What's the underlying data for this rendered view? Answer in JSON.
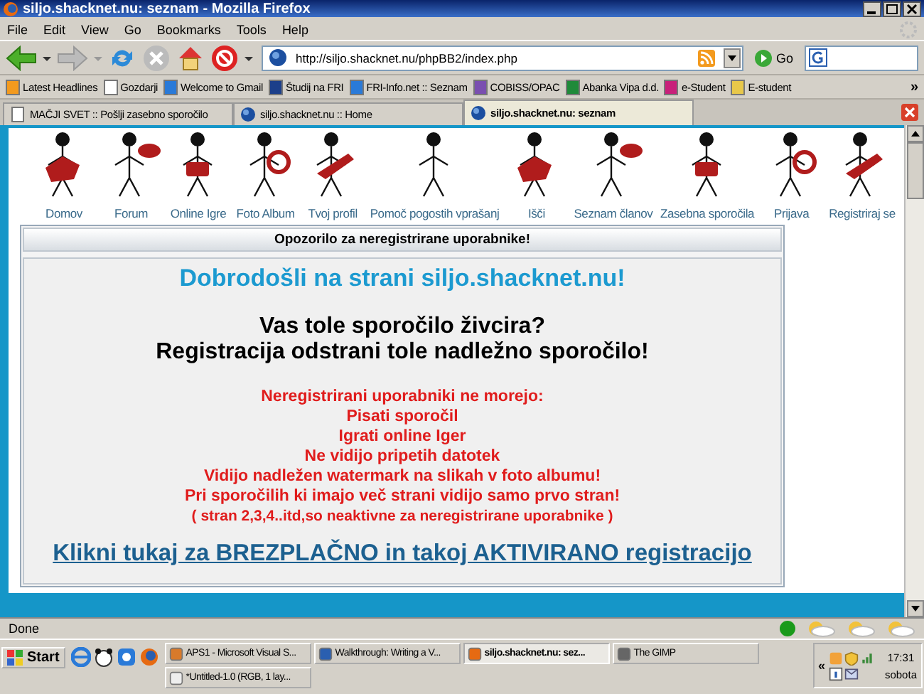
{
  "window": {
    "title": "siljo.shacknet.nu: seznam - Mozilla Firefox"
  },
  "menu": [
    "File",
    "Edit",
    "View",
    "Go",
    "Bookmarks",
    "Tools",
    "Help"
  ],
  "address": {
    "value": "http://siljo.shacknet.nu/phpBB2/index.php",
    "go": "Go"
  },
  "bookmarks": [
    "Latest Headlines",
    "Gozdarji",
    "Welcome to Gmail",
    "Študij na FRI",
    "FRI-Info.net :: Seznam",
    "COBISS/OPAC",
    "Abanka Vipa d.d.",
    "e-Student",
    "E-student"
  ],
  "bookmarks_more": "»",
  "tabs": [
    {
      "label": "MAČJI SVET :: Pošlji zasebno sporočilo",
      "selected": false
    },
    {
      "label": "siljo.shacknet.nu :: Home",
      "selected": false
    },
    {
      "label": "siljo.shacknet.nu: seznam",
      "selected": true
    }
  ],
  "nav": [
    "Domov",
    "Forum",
    "Online Igre",
    "Foto Album",
    "Tvoj profil",
    "Pomoč pogostih vprašanj",
    "Išči",
    "Seznam članov",
    "Zasebna sporočila",
    "Prijava",
    "Registriraj se"
  ],
  "notice": {
    "header": "Opozorilo za neregistrirane uporabnike!",
    "welcome": "Dobrodošli na strani siljo.shacknet.nu!",
    "question": [
      "Vas tole sporočilo živcira?",
      "Registracija odstrani tole nadležno sporočilo!"
    ],
    "list": [
      "Neregistrirani uporabniki ne morejo:",
      "Pisati sporočil",
      "Igrati online Iger",
      "Ne vidijo pripetih datotek",
      "Vidijo nadležen watermark na slikah v foto albumu!",
      "Pri sporočilih ki imajo več strani vidijo samo prvo stran!"
    ],
    "note": "( stran 2,3,4..itd,so neaktivne za neregistrirane uporabnike )",
    "link": "Klikni tukaj za BREZPLAČNO in takoj AKTIVIRANO registracijo"
  },
  "status_bar": "Done",
  "taskbar": {
    "start": "Start",
    "tasks": [
      {
        "label": "APS1 - Microsoft Visual S...",
        "selected": false
      },
      {
        "label": "Walkthrough: Writing a V...",
        "selected": false
      },
      {
        "label": "siljo.shacknet.nu: sez...",
        "selected": true
      },
      {
        "label": "The GIMP",
        "selected": false
      },
      {
        "label": "*Untitled-1.0 (RGB, 1 lay...",
        "selected": false
      }
    ],
    "more": "«",
    "time": "17:31",
    "day": "sobota"
  }
}
